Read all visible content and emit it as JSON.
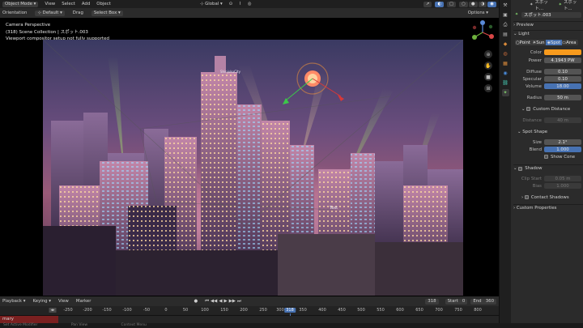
{
  "topbar": {
    "mode": "Object Mode",
    "menus": [
      "View",
      "Select",
      "Add",
      "Object"
    ],
    "transform": "Global",
    "options": "Options"
  },
  "header2": {
    "orientation_label": "Orientation",
    "orientation_value": "Default",
    "drag_label": "Drag",
    "drag_value": "Select Box"
  },
  "overlay": {
    "line1": "Camera Perspective",
    "line2": "(318) Scene Collection | スポット.003",
    "line3": "Viewport compositor setup not fully supported"
  },
  "scene_labels": {
    "top_sign": "ShinjukuCity",
    "tower_sign": "Text"
  },
  "timeline": {
    "menus": [
      "Playback",
      "Keying",
      "View",
      "Marker"
    ],
    "current_frame": "318",
    "start_label": "Start",
    "start_value": "0",
    "end_label": "End",
    "end_value": "360",
    "ruler_ticks": [
      "-250",
      "-200",
      "-150",
      "-100",
      "-50",
      "0",
      "50",
      "100",
      "150",
      "200",
      "250",
      "300",
      "318",
      "350",
      "400",
      "450",
      "500",
      "550",
      "600",
      "650",
      "700",
      "750",
      "800"
    ],
    "track_label": "mary"
  },
  "status": {
    "left": "Set Active Modifier",
    "mid": "Pan View",
    "right": "Context Menu"
  },
  "properties": {
    "header_name": "スポット...",
    "header_name2": "スポット...",
    "object_name": "スポット.003",
    "preview": "Preview",
    "light_section": "Light",
    "light_types": [
      "Point",
      "Sun",
      "Spot",
      "Area"
    ],
    "color_label": "Color",
    "color_value": "#f79a1d",
    "power_label": "Power",
    "power_value": "4.1943 PW",
    "diffuse_label": "Diffuse",
    "diffuse_value": "0.10",
    "specular_label": "Specular",
    "specular_value": "0.10",
    "volume_label": "Volume",
    "volume_value": "18.00",
    "radius_label": "Radius",
    "radius_value": "50 m",
    "custom_distance": "Custom Distance",
    "distance_label": "Distance",
    "distance_value": "40 m",
    "spot_shape": "Spot Shape",
    "size_label": "Size",
    "size_value": "2.1°",
    "blend_label": "Blend",
    "blend_value": "1.000",
    "show_cone": "Show Cone",
    "shadow": "Shadow",
    "clip_start_label": "Clip Start",
    "clip_start_value": "0.05 m",
    "bias_label": "Bias",
    "bias_value": "1.000",
    "contact_shadows": "Contact Shadows",
    "custom_properties": "Custom Properties"
  }
}
